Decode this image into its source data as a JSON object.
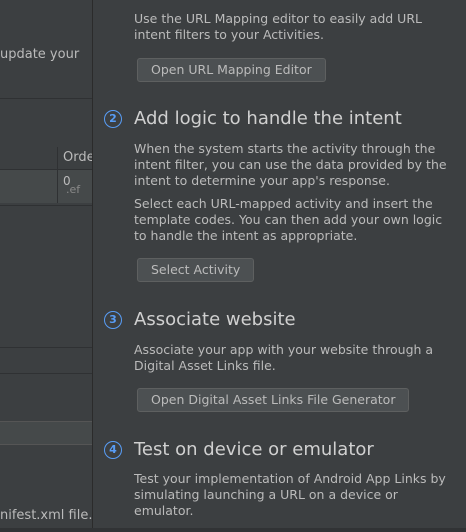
{
  "background_panel": {
    "update_text_fragment": "update your",
    "column_header_fragment": "Orde",
    "cell_value": "0",
    "cell_fragment": ".ef",
    "footer_fragment": "nifest.xml file."
  },
  "assistant": {
    "intro_text": "Use the URL Mapping editor to easily add URL intent filters to your Activities.",
    "open_url_mapping_button": "Open URL Mapping Editor",
    "steps": [
      {
        "number": "2",
        "title": "Add logic to handle the intent",
        "paragraphs": [
          "When the system starts the activity through the intent filter, you can use the data provided by the intent to determine your app's response.",
          "Select each URL-mapped activity and insert the template codes. You can then add your own logic to handle the intent as appropriate."
        ],
        "button": "Select Activity"
      },
      {
        "number": "3",
        "title": "Associate website",
        "paragraphs": [
          "Associate your app with your website through a Digital Asset Links file."
        ],
        "button": "Open Digital Asset Links File Generator"
      },
      {
        "number": "4",
        "title": "Test on device or emulator",
        "paragraphs": [
          "Test your implementation of Android App Links by simulating launching a URL on a device or emulator."
        ]
      }
    ]
  },
  "colors": {
    "background": "#3c3f41",
    "text": "#bbbbbb",
    "title_text": "#d0d0d0",
    "accent_blue": "#589df6",
    "button_fill": "#4c5052",
    "button_border": "#5e6060"
  }
}
